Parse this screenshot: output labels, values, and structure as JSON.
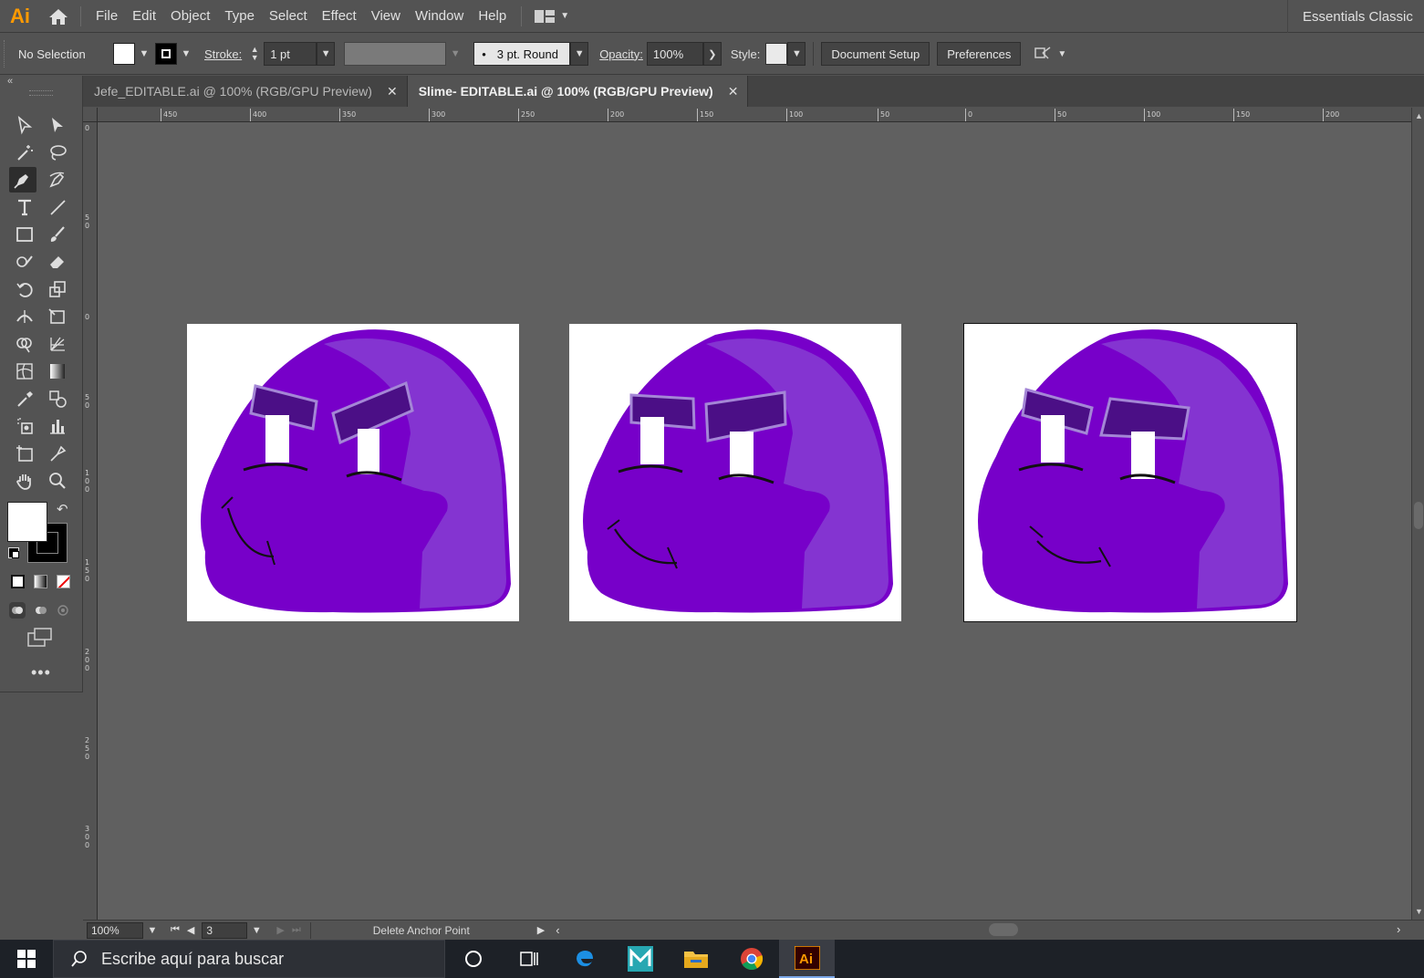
{
  "app": {
    "logo_text": "Ai",
    "workspace": "Essentials Classic"
  },
  "menu": [
    "File",
    "Edit",
    "Object",
    "Type",
    "Select",
    "Effect",
    "View",
    "Window",
    "Help"
  ],
  "control": {
    "selection_label": "No Selection",
    "stroke_label": "Stroke:",
    "stroke_value": "1 pt",
    "brush_label": "3 pt. Round",
    "opacity_label": "Opacity:",
    "opacity_value": "100%",
    "style_label": "Style:",
    "document_setup": "Document Setup",
    "preferences": "Preferences"
  },
  "tabs": [
    {
      "label": "Jefe_EDITABLE.ai @ 100% (RGB/GPU Preview)",
      "active": false
    },
    {
      "label": "Slime- EDITABLE.ai @ 100% (RGB/GPU Preview)",
      "active": true
    }
  ],
  "ruler_top": [
    "450",
    "400",
    "350",
    "300",
    "250",
    "200",
    "150",
    "100",
    "50",
    "0",
    "50",
    "100",
    "150",
    "200"
  ],
  "ruler_left": [
    "0",
    "5\n0",
    "0",
    "5\n0",
    "1\n0\n0",
    "1\n5\n0",
    "2\n0\n0",
    "2\n5\n0",
    "3\n0\n0"
  ],
  "artboards": [
    {
      "variant": "slime-1",
      "selected": false
    },
    {
      "variant": "slime-2",
      "selected": false
    },
    {
      "variant": "slime-3",
      "selected": true
    }
  ],
  "status": {
    "zoom": "100%",
    "artboard_number": "3",
    "current_tool": "Delete Anchor Point"
  },
  "taskbar": {
    "search_placeholder": "Escribe aquí para buscar"
  },
  "colors": {
    "slime_dark": "#7700c9",
    "slime_highlight": "#8434d1",
    "brow": "#4b0f86",
    "brow_highlight": "#a486d6",
    "ai_orange": "#ff9a00"
  }
}
